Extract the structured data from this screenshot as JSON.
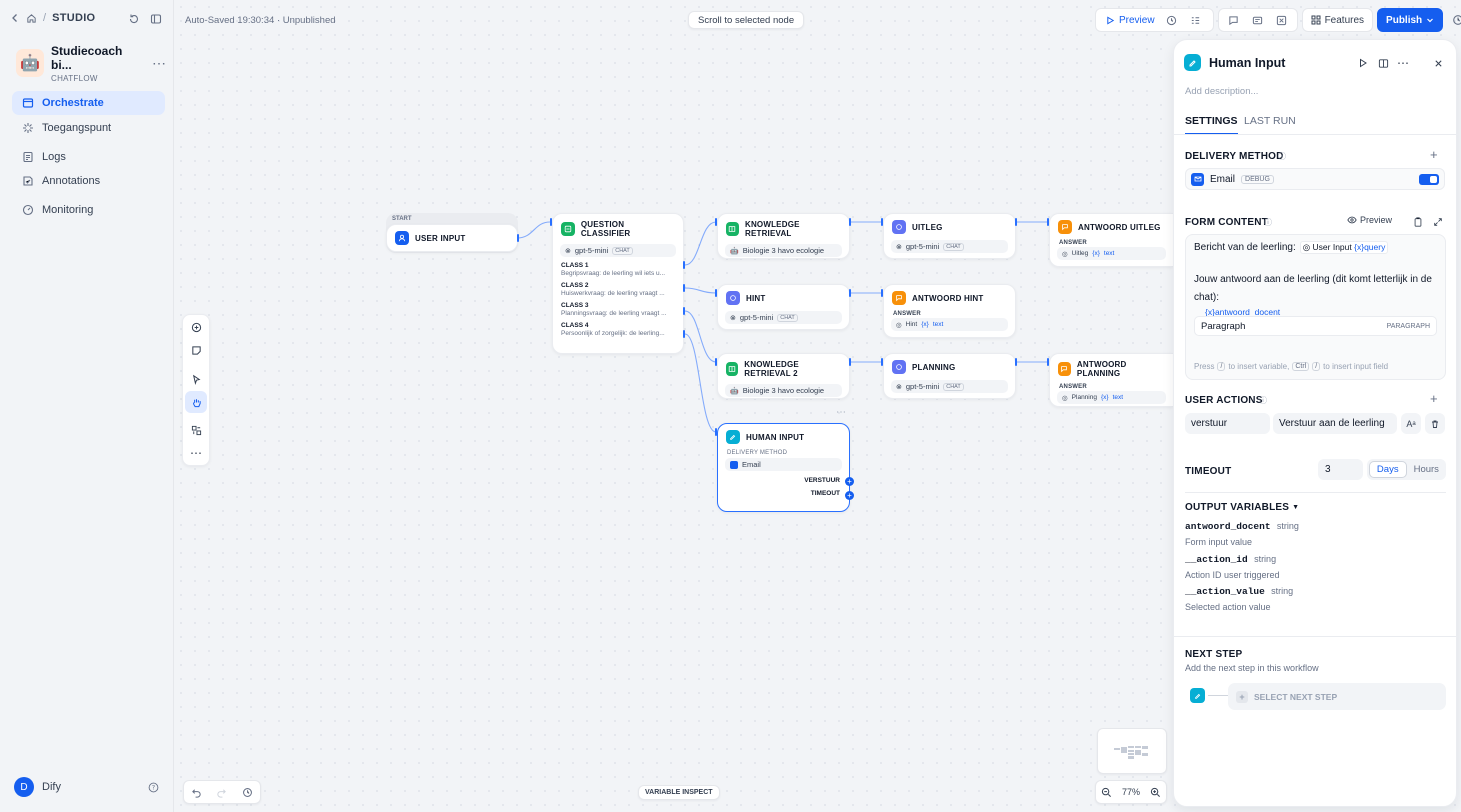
{
  "sidebar": {
    "breadcrumb": "STUDIO",
    "app_name": "Studiecoach bi...",
    "app_type": "CHATFLOW",
    "app_emoji": "🤖",
    "nav": [
      {
        "label": "Orchestrate"
      },
      {
        "label": "Toegangspunt"
      },
      {
        "label": "Logs"
      },
      {
        "label": "Annotations"
      },
      {
        "label": "Monitoring"
      }
    ],
    "user_initial": "D",
    "user_name": "Dify"
  },
  "header": {
    "status": "Auto-Saved 19:30:34 · Unpublished",
    "scroll_hint": "Scroll to selected node",
    "preview": "Preview",
    "features": "Features",
    "publish": "Publish"
  },
  "nodes": {
    "start": {
      "label": "START",
      "title": "USER INPUT"
    },
    "classifier": {
      "title": "QUESTION CLASSIFIER",
      "model": "gpt-5-mini",
      "model_tag": "CHAT",
      "classes": [
        {
          "name": "CLASS 1",
          "desc": "Begripsvraag: de leerling wil iets u..."
        },
        {
          "name": "CLASS 2",
          "desc": "Huiswerkvraag: de leerling vraagt ..."
        },
        {
          "name": "CLASS 3",
          "desc": "Planningsvraag: de leerling vraagt ..."
        },
        {
          "name": "CLASS 4",
          "desc": "Persoonlijk of zorgelijk: de leerling..."
        }
      ]
    },
    "kr1": {
      "title": "KNOWLEDGE RETRIEVAL",
      "kb": "Biologie 3 havo ecologie"
    },
    "uitleg": {
      "title": "UITLEG",
      "model": "gpt-5-mini",
      "model_tag": "CHAT"
    },
    "ant_uitleg": {
      "title": "ANTWOORD UITLEG",
      "sub": "ANSWER",
      "src": "Uitleg",
      "var": "text"
    },
    "hint": {
      "title": "HINT",
      "model": "gpt-5-mini",
      "model_tag": "CHAT"
    },
    "ant_hint": {
      "title": "ANTWOORD HINT",
      "sub": "ANSWER",
      "src": "Hint",
      "var": "text"
    },
    "kr2": {
      "title": "KNOWLEDGE RETRIEVAL 2",
      "kb": "Biologie 3 havo ecologie"
    },
    "planning": {
      "title": "PLANNING",
      "model": "gpt-5-mini",
      "model_tag": "CHAT"
    },
    "ant_planning": {
      "title": "ANTWOORD PLANNING",
      "sub": "ANSWER",
      "src": "Planning",
      "var": "text"
    },
    "human": {
      "title": "HUMAN INPUT",
      "sub": "DELIVERY METHOD",
      "method": "Email",
      "out1": "VERSTUUR",
      "out2": "TIMEOUT"
    }
  },
  "bottom": {
    "variable_inspect": "VARIABLE INSPECT",
    "zoom": "77%"
  },
  "panel": {
    "title": "Human Input",
    "desc_placeholder": "Add description...",
    "tabs": [
      "SETTINGS",
      "LAST RUN"
    ],
    "delivery_label": "DELIVERY METHOD",
    "delivery_item": "Email",
    "delivery_tag": "DEBUG",
    "delivery_enabled": true,
    "form_label": "FORM CONTENT",
    "form_preview": "Preview",
    "form_line1": "Bericht van de leerling:",
    "form_ref1_node": "User Input",
    "form_ref1_var": "query",
    "form_line2": "Jouw antwoord aan de leerling (dit komt letterlijk in de chat):",
    "form_field_var": "antwoord_docent",
    "form_field_name": "Paragraph",
    "form_field_type": "PARAGRAPH",
    "form_hint_a": "Press",
    "form_hint_key1": "/",
    "form_hint_b": "to insert variable,",
    "form_hint_key2": "Ctrl",
    "form_hint_key3": "/",
    "form_hint_c": "to insert input field",
    "actions_label": "USER ACTIONS",
    "action_id": "verstuur",
    "action_text": "Verstuur aan de leerling",
    "timeout_label": "TIMEOUT",
    "timeout_value": "3",
    "timeout_units": [
      "Days",
      "Hours"
    ],
    "output_label": "OUTPUT VARIABLES",
    "outputs": [
      {
        "name": "antwoord_docent",
        "type": "string",
        "desc": "Form input value"
      },
      {
        "name": "__action_id",
        "type": "string",
        "desc": "Action ID user triggered"
      },
      {
        "name": "__action_value",
        "type": "string",
        "desc": "Selected action value"
      }
    ],
    "next_label": "NEXT STEP",
    "next_desc": "Add the next step in this workflow",
    "next_button": "SELECT NEXT STEP"
  },
  "colors": {
    "accent": "#155eef",
    "green": "#16b364",
    "indigo": "#6172f3",
    "orange": "#f79009",
    "cyan": "#06aed4"
  }
}
